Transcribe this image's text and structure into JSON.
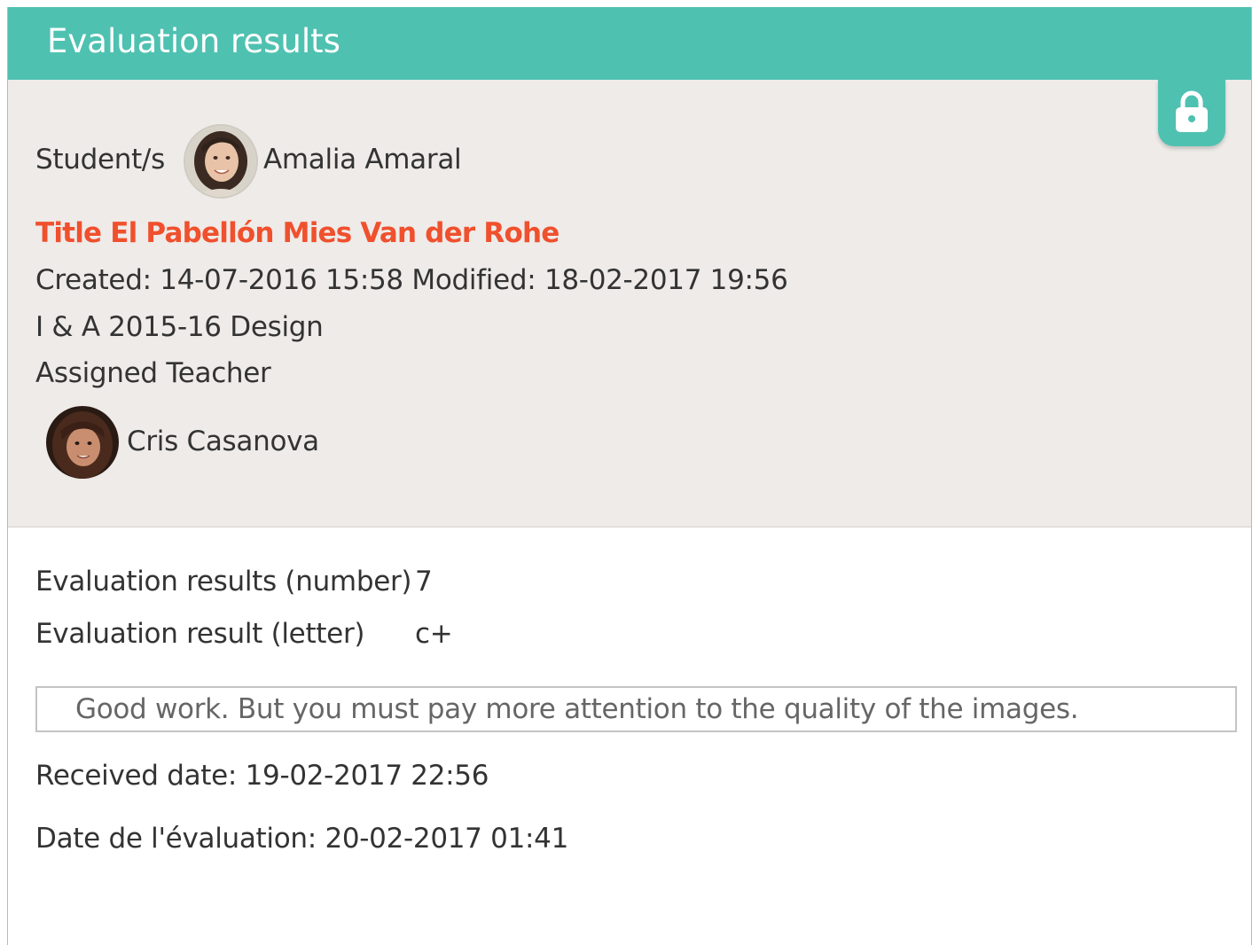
{
  "header": {
    "title": "Evaluation results"
  },
  "info": {
    "lock_icon": "lock-icon",
    "students_label": "Student/s",
    "student_name": "Amalia Amaral",
    "title_line": "Title El Pabellón Mies Van der Rohe",
    "dates_line": "Created: 14-07-2016 15:58 Modified: 18-02-2017 19:56",
    "course_line": "I & A 2015-16 Design",
    "assigned_teacher_label": "Assigned Teacher",
    "teacher_name": "Cris Casanova"
  },
  "evaluation": {
    "number_label": "Evaluation results (number)",
    "number_value": "7",
    "letter_label": "Evaluation result (letter)",
    "letter_value": "c+",
    "comment": "Good work. But you must pay more attention to the quality of the images.",
    "received_date": "Received date: 19-02-2017 22:56",
    "evaluation_date": "Date de l'évaluation: 20-02-2017 01:41"
  },
  "colors": {
    "accent": "#4fc1b1",
    "title_red": "#f0502d",
    "info_background": "#eeebe8"
  }
}
